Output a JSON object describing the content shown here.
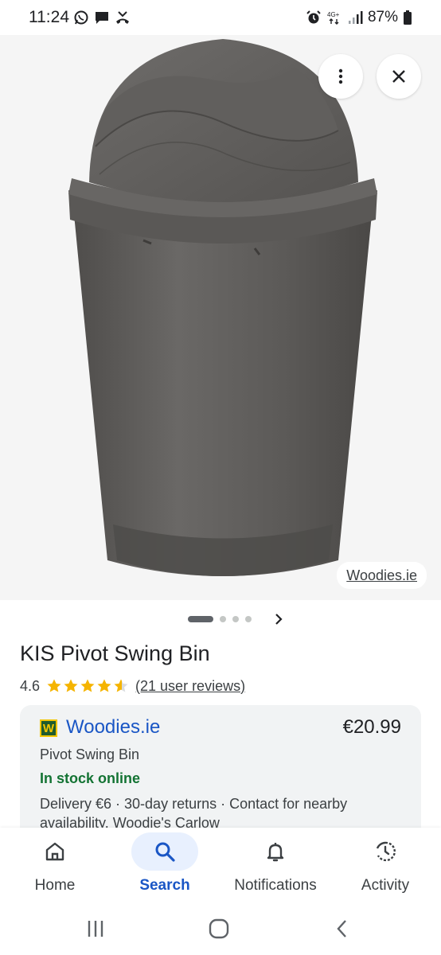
{
  "status_bar": {
    "time": "11:24",
    "battery": "87%",
    "left_icons": [
      "whatsapp-icon",
      "message-icon",
      "missed-call-icon"
    ],
    "right_icons": [
      "alarm-icon",
      "4g-icon",
      "signal-icon",
      "battery-icon"
    ]
  },
  "image": {
    "source": "Woodies.ie",
    "more_icon": "more-vert-icon",
    "close_icon": "close-icon"
  },
  "carousel": {
    "total": 4,
    "active": 1
  },
  "product": {
    "title": "KIS Pivot Swing Bin",
    "rating": "4.6",
    "stars": 4.6,
    "reviews": "(21 user reviews)"
  },
  "seller": {
    "logo_letter": "W",
    "name": "Woodies.ie",
    "price": "€20.99",
    "product_name": "Pivot Swing Bin",
    "stock": "In stock online",
    "delivery": "Delivery €6 · 30-day returns · Contact for nearby availability. Woodie's Carlow"
  },
  "bottom_nav": {
    "items": [
      {
        "label": "Home",
        "icon": "home-icon"
      },
      {
        "label": "Search",
        "icon": "search-icon"
      },
      {
        "label": "Notifications",
        "icon": "bell-icon"
      },
      {
        "label": "Activity",
        "icon": "activity-icon"
      }
    ],
    "active": "Search"
  },
  "colors": {
    "link_blue": "#1a56c5",
    "stock_green": "#137333",
    "star_yellow": "#f5b400",
    "bin_gray": "#5f5d5b"
  }
}
